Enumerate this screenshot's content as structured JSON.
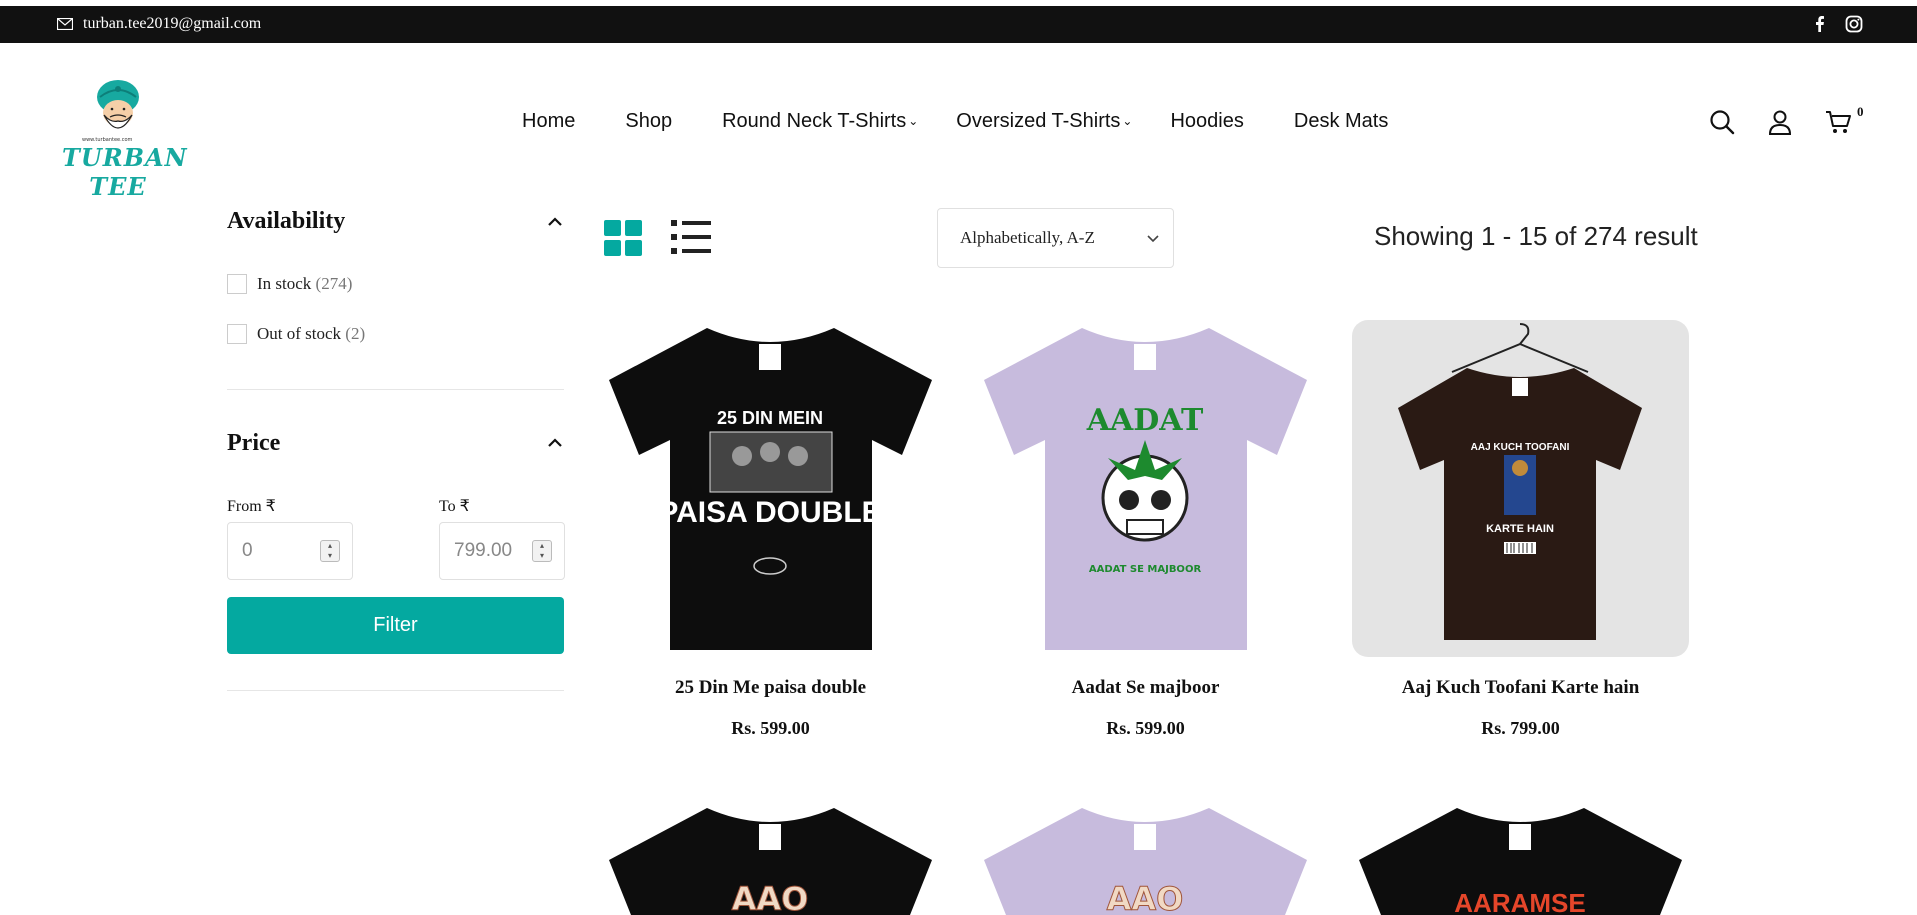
{
  "topbar": {
    "email": "turban.tee2019@gmail.com",
    "email_icon": "mail-icon",
    "social": [
      "facebook-icon",
      "instagram-icon"
    ]
  },
  "brand": {
    "name": "TURBAN TEE",
    "site": "www.turbantee.com",
    "accent": "#04a9a0"
  },
  "nav": {
    "items": [
      {
        "label": "Home",
        "dropdown": false
      },
      {
        "label": "Shop",
        "dropdown": false
      },
      {
        "label": "Round Neck T-Shirts",
        "dropdown": true
      },
      {
        "label": "Oversized T-Shirts",
        "dropdown": true
      },
      {
        "label": "Hoodies",
        "dropdown": false
      },
      {
        "label": "Desk Mats",
        "dropdown": false
      }
    ],
    "cart_count": "0"
  },
  "sidebar": {
    "availability": {
      "title": "Availability",
      "options": [
        {
          "label": "In stock",
          "count": "(274)"
        },
        {
          "label": "Out of stock",
          "count": "(2)"
        }
      ]
    },
    "price": {
      "title": "Price",
      "from_label": "From ₹",
      "to_label": "To ₹",
      "from_placeholder": "0",
      "to_placeholder": "799.00",
      "filter_label": "Filter"
    }
  },
  "toolbar": {
    "sort_value": "Alphabetically, A-Z",
    "showing": "Showing 1 - 15 of 274 result"
  },
  "products": [
    {
      "title": "25 Din Me paisa double",
      "price": "Rs. 599.00",
      "shirt_color": "#0d0d0d",
      "bg": "#ffffff",
      "print_top": "25 DIN MEIN",
      "print_bottom": "PAISA DOUBLE"
    },
    {
      "title": "Aadat Se majboor",
      "price": "Rs. 599.00",
      "shirt_color": "#c7bbdd",
      "bg": "#ffffff",
      "print_top": "AADAT",
      "print_bottom": "AADAT SE MAJBOOR"
    },
    {
      "title": "Aaj Kuch Toofani Karte hain",
      "price": "Rs. 799.00",
      "shirt_color": "#2a1a14",
      "bg": "#e4e4e4",
      "print_top": "AAJ KUCH TOOFANI",
      "print_bottom": "KARTE HAIN"
    },
    {
      "title": "",
      "price": "",
      "shirt_color": "#0d0d0d",
      "bg": "#ffffff",
      "print_top": "AAO",
      "print_bottom": ""
    },
    {
      "title": "",
      "price": "",
      "shirt_color": "#c7bbdd",
      "bg": "#ffffff",
      "print_top": "AAO",
      "print_bottom": ""
    },
    {
      "title": "",
      "price": "",
      "shirt_color": "#0d0d0d",
      "bg": "#ffffff",
      "print_top": "AARAMSE",
      "print_bottom": ""
    }
  ]
}
